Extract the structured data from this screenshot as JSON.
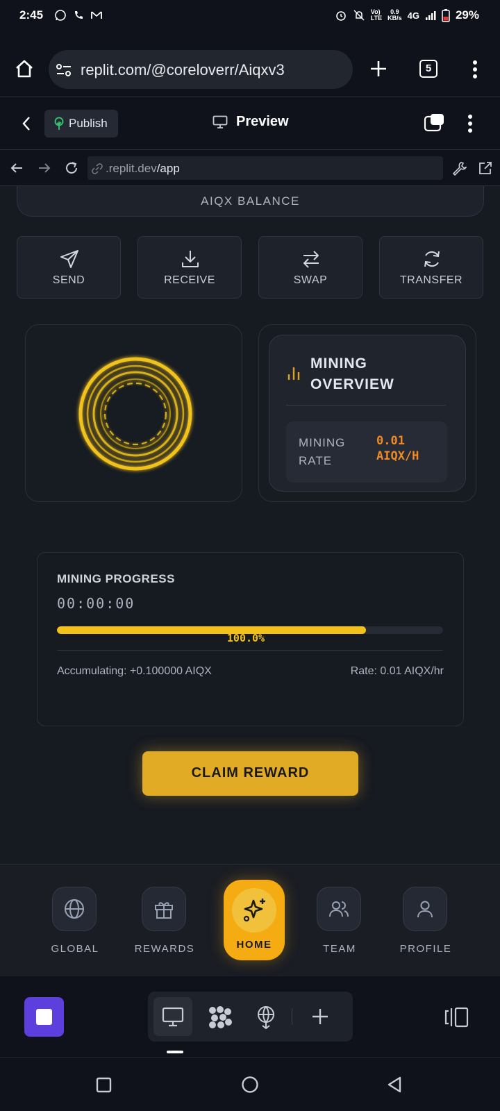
{
  "status_bar": {
    "time": "2:45",
    "network": "4G",
    "battery_percent": "29%",
    "speed_value": "0.9",
    "speed_unit": "KB/s"
  },
  "browser": {
    "url": "replit.com/@coreloverr/Aiqxv3",
    "tab_count": "5"
  },
  "replit_toolbar": {
    "publish_label": "Publish",
    "preview_label": "Preview"
  },
  "preview_nav": {
    "url_domain": ".replit.dev",
    "url_path": "/app"
  },
  "app": {
    "balance_label": "AIQX BALANCE",
    "actions": [
      {
        "label": "SEND",
        "icon": "send-icon"
      },
      {
        "label": "RECEIVE",
        "icon": "download-icon"
      },
      {
        "label": "SWAP",
        "icon": "swap-icon"
      },
      {
        "label": "TRANSFER",
        "icon": "refresh-icon"
      }
    ],
    "overview": {
      "title": "MINING OVERVIEW",
      "rate_label": "MINING RATE",
      "rate_value": "0.01 AIQX/H"
    },
    "progress": {
      "title": "MINING PROGRESS",
      "timer": "00:00:00",
      "percent_label": "100.0%",
      "bar_fill_fraction": 0.8,
      "accumulating": "Accumulating: +0.100000 AIQX",
      "rate": "Rate: 0.01 AIQX/hr"
    },
    "claim_label": "CLAIM REWARD",
    "colors": {
      "accent": "#f5ab12",
      "rate_orange": "#f08a24",
      "ring_gold": "#f2c21b"
    }
  },
  "bottom_nav": {
    "items": [
      {
        "label": "GLOBAL",
        "icon": "globe-icon"
      },
      {
        "label": "REWARDS",
        "icon": "gift-icon"
      },
      {
        "label": "HOME",
        "icon": "sparkles-icon",
        "active": true
      },
      {
        "label": "TEAM",
        "icon": "users-icon"
      },
      {
        "label": "PROFILE",
        "icon": "user-icon"
      }
    ]
  }
}
